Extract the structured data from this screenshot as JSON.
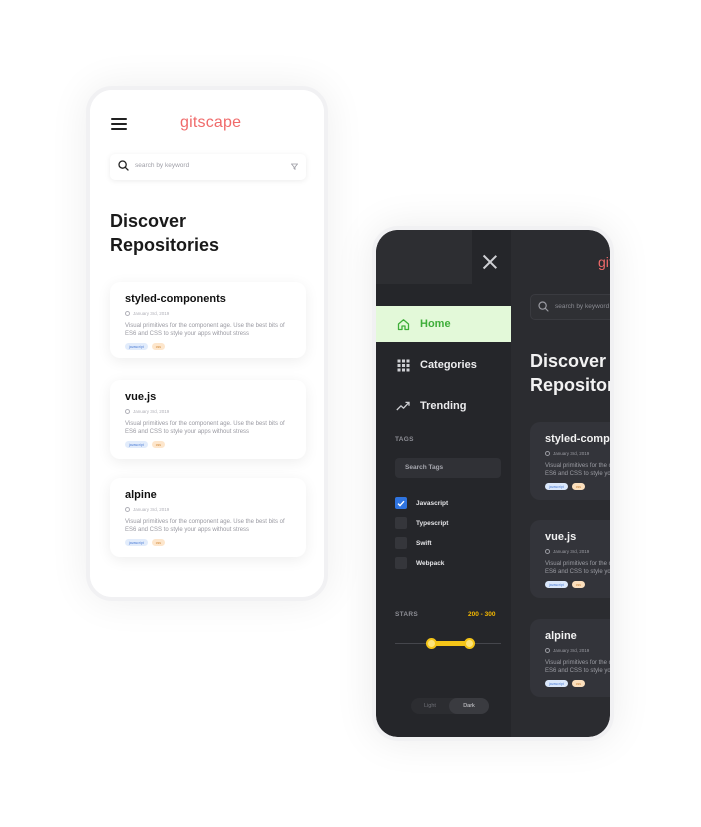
{
  "brand": {
    "logo_prefix": "git",
    "logo_suffix": "scape",
    "color": "#f06a6a"
  },
  "search": {
    "placeholder": "search by keyword"
  },
  "page_title_line1": "Discover",
  "page_title_line2": "Repositories",
  "repos": [
    {
      "name": "styled-components",
      "date": "January 3rd, 2019",
      "description": "Visual primitives for the component age. Use the best bits of ES6 and CSS to style your apps without stress",
      "tags": [
        "javascript",
        "css"
      ]
    },
    {
      "name": "vue.js",
      "date": "January 3rd, 2019",
      "description": "Visual primitives for the component age. Use the best bits of ES6 and CSS to style your apps without stress",
      "tags": [
        "javascript",
        "css"
      ]
    },
    {
      "name": "alpine",
      "date": "January 3rd, 2019",
      "description": "Visual primitives for the component age. Use the best bits of ES6 and CSS to style your apps without stress",
      "tags": [
        "javascript",
        "css"
      ]
    }
  ],
  "drawer": {
    "nav": [
      {
        "label": "Home",
        "icon": "home-icon",
        "active": true
      },
      {
        "label": "Categories",
        "icon": "grid-icon",
        "active": false
      },
      {
        "label": "Trending",
        "icon": "trending-icon",
        "active": false
      }
    ],
    "tags_title": "TAGS",
    "tag_search_placeholder": "Search Tags",
    "tag_options": [
      {
        "label": "Javascript",
        "checked": true
      },
      {
        "label": "Typescript",
        "checked": false
      },
      {
        "label": "Swift",
        "checked": false
      },
      {
        "label": "Webpack",
        "checked": false
      }
    ],
    "stars_title": "STARS",
    "stars_range": "200 - 300",
    "stars_range_values": [
      200,
      300
    ],
    "theme_light": "Light",
    "theme_dark": "Dark",
    "theme_selected": "Dark"
  },
  "colors": {
    "accent_green": "#3fae3a",
    "accent_yellow": "#f5c518",
    "checkbox_blue": "#2f74e0",
    "dark_bg": "#2a2b2f"
  }
}
